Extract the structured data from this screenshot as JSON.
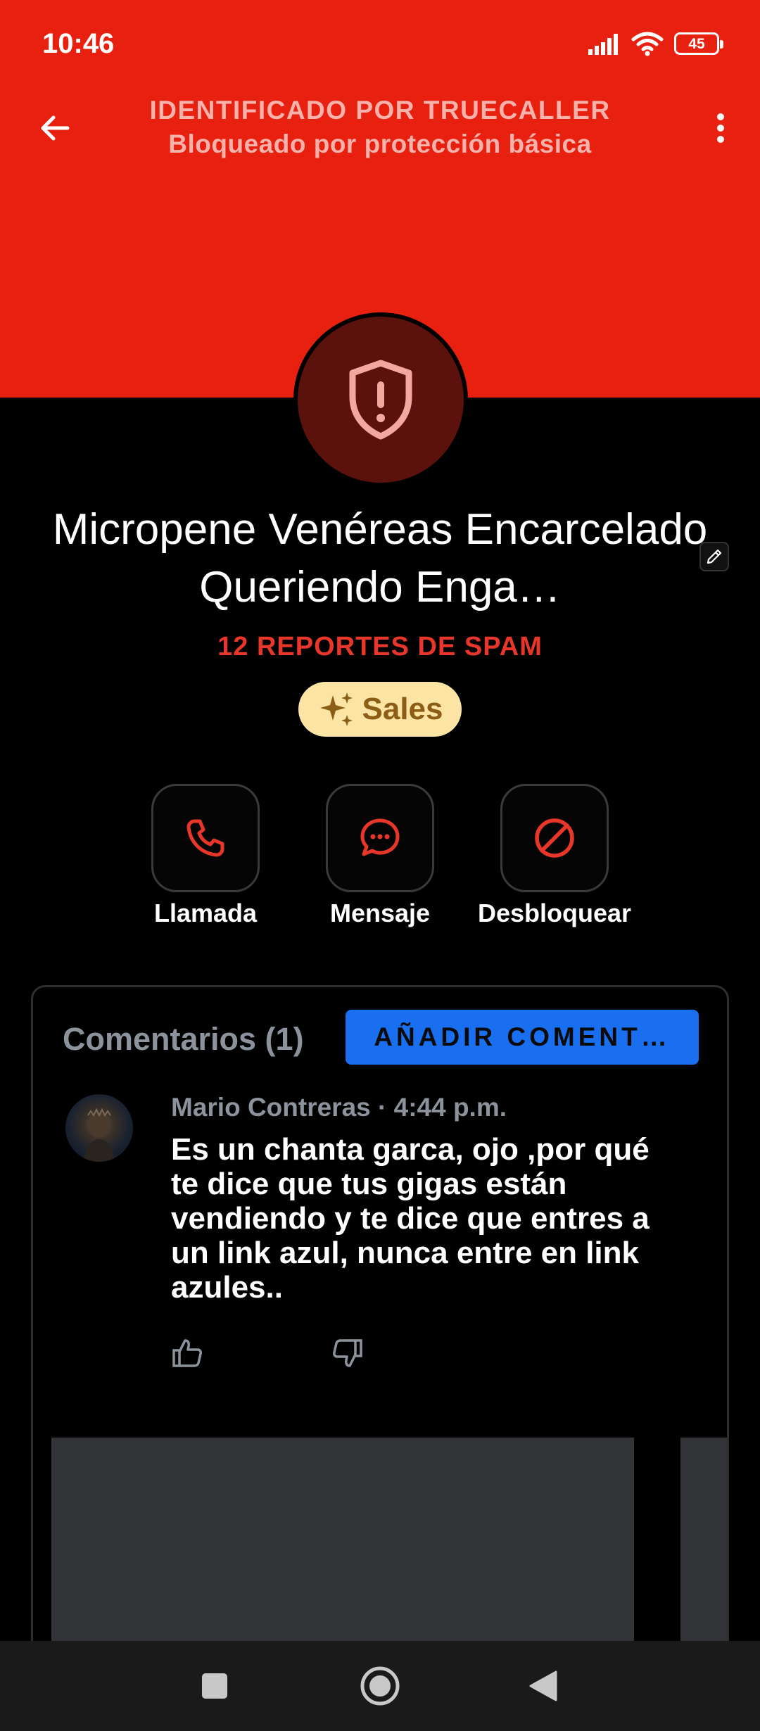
{
  "status_bar": {
    "time": "10:46",
    "battery": "45",
    "icons": [
      "signal-icon",
      "wifi-icon",
      "battery-icon"
    ]
  },
  "header": {
    "line1": "IDENTIFICADO POR TRUECALLER",
    "line2": "Bloqueado por protección básica",
    "background_color": "#e8200f",
    "back_icon": "arrow-left-icon",
    "menu_icon": "more-vertical-icon"
  },
  "profile": {
    "avatar_icon": "shield-alert-icon",
    "name": "Micropene Venéreas Encarcelado Queriendo Enga…",
    "spam_reports": "12 REPORTES DE SPAM",
    "tag": "Sales",
    "tag_icon": "sparkle-icon",
    "edit_icon": "pencil-icon"
  },
  "actions": [
    {
      "label": "Llamada",
      "icon": "phone-icon"
    },
    {
      "label": "Mensaje",
      "icon": "chat-icon"
    },
    {
      "label": "Desbloquear",
      "icon": "block-icon"
    }
  ],
  "comments": {
    "title": "Comentarios (1)",
    "add_button": "AÑADIR COMENT…",
    "items": [
      {
        "author_time": "Mario Contreras · 4:44 p.m.",
        "text": "Es un chanta garca, ojo ,por qué te dice que tus gigas están vendiendo y te dice que entres a un link azul, nunca entre en link azules.."
      }
    ]
  },
  "nav": {
    "icons": [
      "recents-icon",
      "home-icon",
      "back-icon"
    ]
  },
  "colors": {
    "accent_red": "#e8200f",
    "spam_red": "#e8372a",
    "button_blue": "#1a6ef0",
    "tag_bg": "#fce5a4"
  }
}
